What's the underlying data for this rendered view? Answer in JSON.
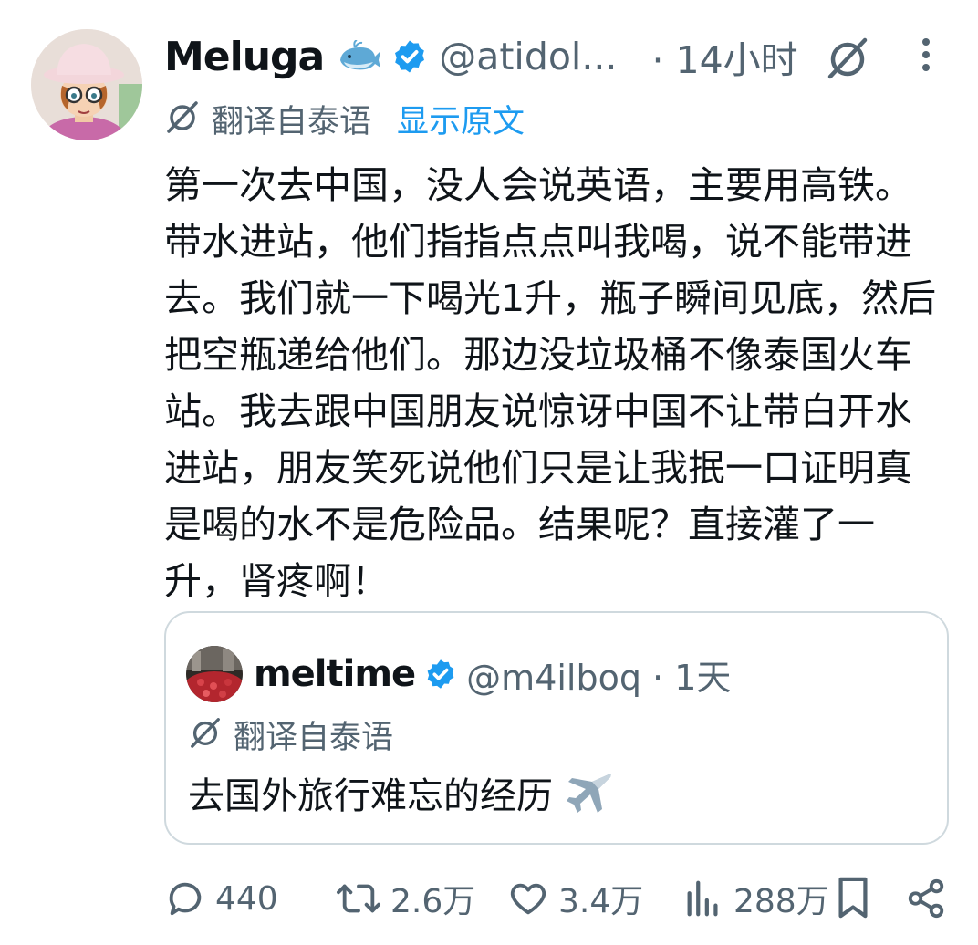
{
  "post": {
    "author_name": "Meluga",
    "author_handle": "@atidol...",
    "time": "· 14小时",
    "translate_label": "翻译自泰语",
    "show_original": "显示原文",
    "text": "第一次去中国，没人会说英语，主要用高铁。带水进站，他们指指点点叫我喝，说不能带进去。我们就一下喝光1升，瓶子瞬间见底，然后把空瓶递给他们。那边没垃圾桶不像泰国火车站。我去跟中国朋友说惊讶中国不让带白开水进站，朋友笑死说他们只是让我抿一口证明真是喝的水不是危险品。结果呢？直接灌了一升，肾疼啊！"
  },
  "quote": {
    "author_name": "meltime",
    "author_handle": "@m4ilboq · 1天",
    "translate_label": "翻译自泰语",
    "text": "去国外旅行难忘的经历"
  },
  "actions": {
    "replies": "440",
    "reposts": "2.6万",
    "likes": "3.4万",
    "views": "288万"
  },
  "icons": [
    "whale-emoji-icon",
    "verified-badge-icon",
    "grok-icon",
    "more-icon",
    "translate-icon",
    "airplane-emoji-icon",
    "reply-icon",
    "repost-icon",
    "like-icon",
    "views-icon",
    "bookmark-icon",
    "share-icon"
  ],
  "colors": {
    "verified": "#1d9bf0",
    "link": "#1d9bf0",
    "secondary_text": "#536471",
    "border": "#cfd9de"
  }
}
